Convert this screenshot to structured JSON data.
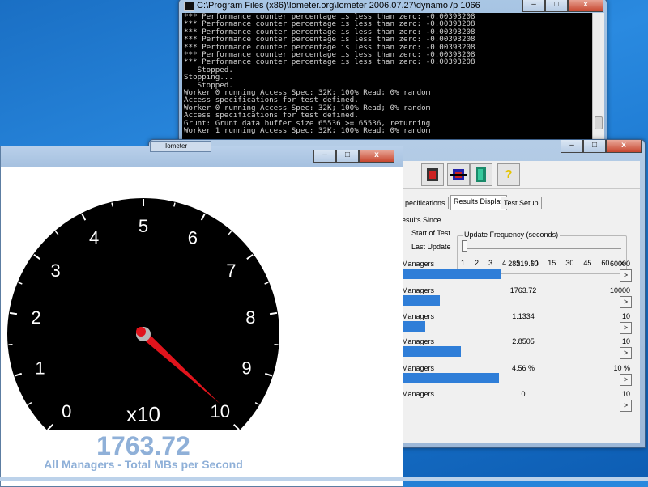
{
  "console": {
    "title": "C:\\Program Files (x86)\\Iometer.org\\Iometer 2006.07.27\\dynamo /p 1066",
    "lines": [
      "*** Performance counter percentage is less than zero: -0.00393208",
      "*** Performance counter percentage is less than zero: -0.00393208",
      "*** Performance counter percentage is less than zero: -0.00393208",
      "*** Performance counter percentage is less than zero: -0.00393208",
      "*** Performance counter percentage is less than zero: -0.00393208",
      "*** Performance counter percentage is less than zero: -0.00393208",
      "*** Performance counter percentage is less than zero: -0.00393208",
      "   Stopped.",
      "Stopping...",
      "   Stopped.",
      "Worker 0 running Access Spec: 32K; 100% Read; 0% random",
      "Access specifications for test defined.",
      "Worker 0 running Access Spec: 32K; 100% Read; 0% random",
      "Access specifications for test defined.",
      "Grunt: Grunt data buffer size 65536 >= 65536, returning",
      "Worker 1 running Access Spec: 32K; 100% Read; 0% random"
    ],
    "minimize": "–",
    "maximize": "□",
    "close": "x"
  },
  "iometer": {
    "title": "Iometer",
    "minimize": "–",
    "maximize": "□",
    "close": "x",
    "toolbar_icons": [
      "workers-icon",
      "disconnect-icon",
      "exit-icon",
      "help-icon"
    ],
    "tabs": [
      "pecifications",
      "Results Display",
      "Test Setup"
    ],
    "results_since_label": "esults Since",
    "start_of_test": "Start of Test",
    "last_update": "Last Update",
    "update_frequency_label": "Update Frequency (seconds)",
    "update_ticks": [
      "1",
      "2",
      "3",
      "4",
      "5",
      "10",
      "15",
      "30",
      "45",
      "60",
      "∞"
    ],
    "rows": [
      {
        "label": "Managers",
        "value": "28219.60",
        "max": "60000",
        "fill": 0.47
      },
      {
        "label": "Managers",
        "value": "1763.72",
        "max": "10000",
        "fill": 0.18
      },
      {
        "label": "Managers",
        "value": "1.1334",
        "max": "10",
        "fill": 0.11
      },
      {
        "label": "Managers",
        "value": "2.8505",
        "max": "10",
        "fill": 0.28
      },
      {
        "label": "Managers",
        "value": "4.56 %",
        "max": "10 %",
        "fill": 0.46
      },
      {
        "label": "Managers",
        "value": "0",
        "max": "10",
        "fill": 0.0
      }
    ],
    "row_button": ">"
  },
  "gauge_window": {
    "tab_label": "Iometer",
    "minimize": "–",
    "maximize": "□",
    "close": "x",
    "dial_labels": [
      "0",
      "1",
      "2",
      "3",
      "4",
      "5",
      "6",
      "7",
      "8",
      "9",
      "10"
    ],
    "multiplier": "x10",
    "needle_value": 9.9,
    "readout": "1763.72",
    "caption": "All Managers - Total MBs per Second",
    "needle_color": "#e0141c"
  }
}
